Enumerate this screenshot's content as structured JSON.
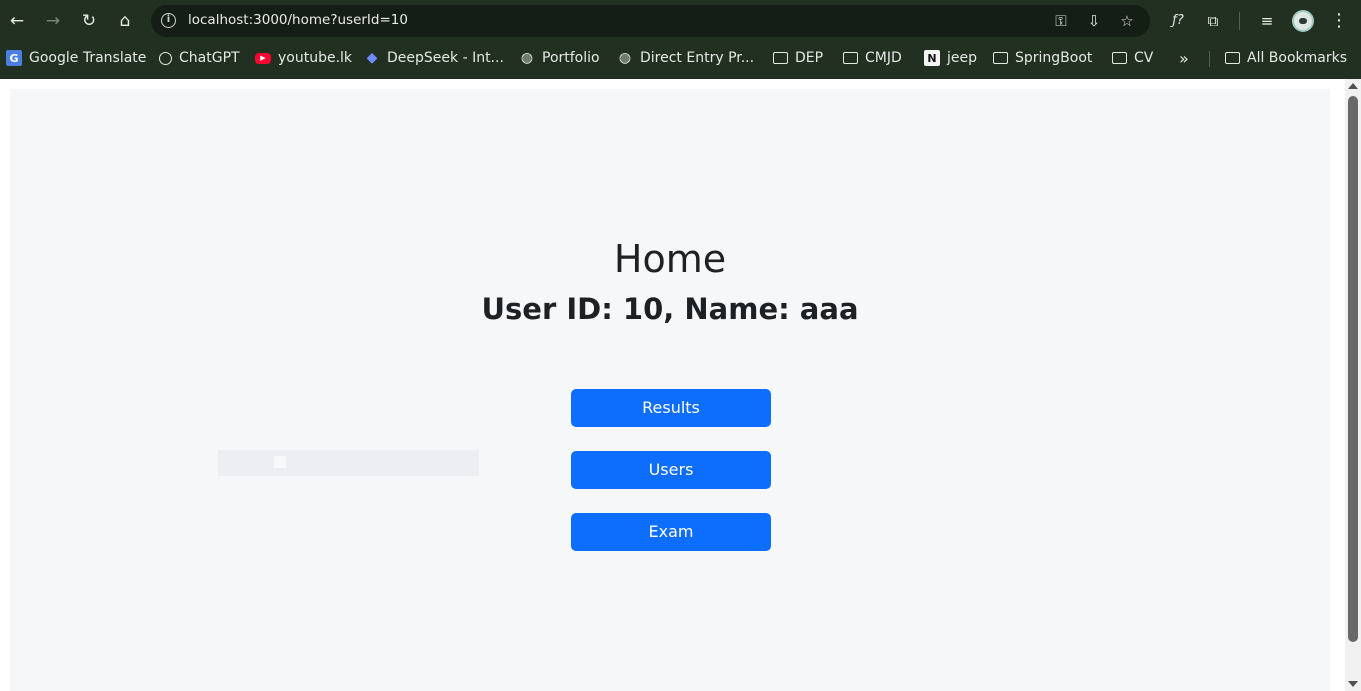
{
  "browser": {
    "url": "localhost:3000/home?userId=10",
    "icons": {
      "back": "arrow-left-icon",
      "forward": "arrow-right-icon",
      "reload": "reload-icon",
      "home": "home-icon",
      "site_info": "info-icon",
      "password": "key-icon",
      "install": "install-app-icon",
      "bookmark": "star-icon",
      "formula": "formula-extension-icon",
      "extensions": "puzzle-icon",
      "media": "media-controls-icon",
      "profile": "avatar",
      "menu": "kebab-menu-icon"
    },
    "glyphs": {
      "back": "←",
      "forward": "→",
      "reload": "↻",
      "home": "⌂",
      "info": "i",
      "password": "⚿",
      "install": "⇩",
      "bookmark": "☆",
      "formula": "ƒ?",
      "extensions": "⧉",
      "media": "≡",
      "menu": "⋮",
      "overflow": "»",
      "gpt": "",
      "yt": "▶",
      "ds": "◆",
      "globe": "◍",
      "gt": "G",
      "notion": "N"
    }
  },
  "bookmarks": [
    {
      "label": "Google Translate",
      "icon": "google-translate-icon"
    },
    {
      "label": "ChatGPT",
      "icon": "chatgpt-icon"
    },
    {
      "label": "youtube.lk",
      "icon": "youtube-icon"
    },
    {
      "label": "DeepSeek - Int...",
      "icon": "deepseek-icon"
    },
    {
      "label": "Portfolio",
      "icon": "globe-icon"
    },
    {
      "label": "Direct Entry Pr...",
      "icon": "globe-icon"
    },
    {
      "label": "DEP",
      "icon": "folder-icon"
    },
    {
      "label": "CMJD",
      "icon": "folder-icon"
    },
    {
      "label": "jeep",
      "icon": "notion-icon"
    },
    {
      "label": "SpringBoot",
      "icon": "folder-icon"
    },
    {
      "label": "CV",
      "icon": "folder-icon"
    }
  ],
  "all_bookmarks_label": "All Bookmarks",
  "page": {
    "title": "Home",
    "subtitle": "User ID: 10, Name: aaa",
    "buttons": {
      "results": "Results",
      "users": "Users",
      "exam": "Exam"
    },
    "accent_color": "#0d6efd",
    "background_color": "#f5f7f9"
  }
}
